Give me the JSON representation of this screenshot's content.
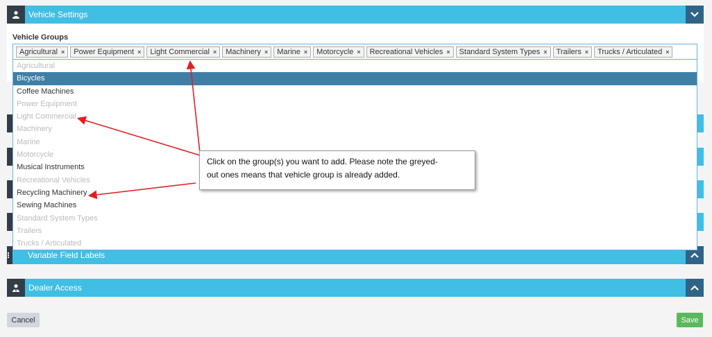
{
  "panels": {
    "vehicle_settings": {
      "title": "Vehicle Settings"
    },
    "variable_field_labels": {
      "title": "Variable Field Labels"
    },
    "dealer_access": {
      "title": "Dealer Access"
    }
  },
  "vehicle_groups": {
    "label": "Vehicle Groups",
    "selected": [
      "Agricultural",
      "Power Equipment",
      "Light Commercial",
      "Machinery",
      "Marine",
      "Motorcycle",
      "Recreational Vehicles",
      "Standard System Types",
      "Trailers",
      "Trucks / Articulated"
    ],
    "remove_symbol": "×",
    "options": [
      {
        "label": "Agricultural",
        "state": "disabled"
      },
      {
        "label": "Bicycles",
        "state": "highlighted"
      },
      {
        "label": "Coffee Machines",
        "state": "normal"
      },
      {
        "label": "Power Equipment",
        "state": "disabled"
      },
      {
        "label": "Light Commercial",
        "state": "disabled"
      },
      {
        "label": "Machinery",
        "state": "disabled"
      },
      {
        "label": "Marine",
        "state": "disabled"
      },
      {
        "label": "Motorcycle",
        "state": "disabled"
      },
      {
        "label": "Musical Instruments",
        "state": "normal"
      },
      {
        "label": "Recreational Vehicles",
        "state": "disabled"
      },
      {
        "label": "Recycling Machinery",
        "state": "normal"
      },
      {
        "label": "Sewing Machines",
        "state": "normal"
      },
      {
        "label": "Standard System Types",
        "state": "disabled"
      },
      {
        "label": "Trailers",
        "state": "disabled"
      },
      {
        "label": "Trucks / Articulated",
        "state": "disabled"
      }
    ]
  },
  "callout": {
    "line1": "Click on the group(s) you want to add. Please note the greyed-",
    "line2": "out ones means that vehicle group is already added."
  },
  "buttons": {
    "cancel": "Cancel",
    "save": "Save"
  },
  "colors": {
    "panel_bar": "#41bee4",
    "icon_box": "#333d47",
    "toggle_box": "#2f6488",
    "highlight": "#3f7fa6",
    "save_button": "#5cb85c",
    "arrow": "#e02020"
  },
  "icons": {
    "vehicle_settings": "user-icon",
    "variable_field_labels": "list-icon",
    "dealer_access": "user-tie-icon",
    "collapse": "chevron-down-icon",
    "expand": "chevron-up-icon"
  }
}
